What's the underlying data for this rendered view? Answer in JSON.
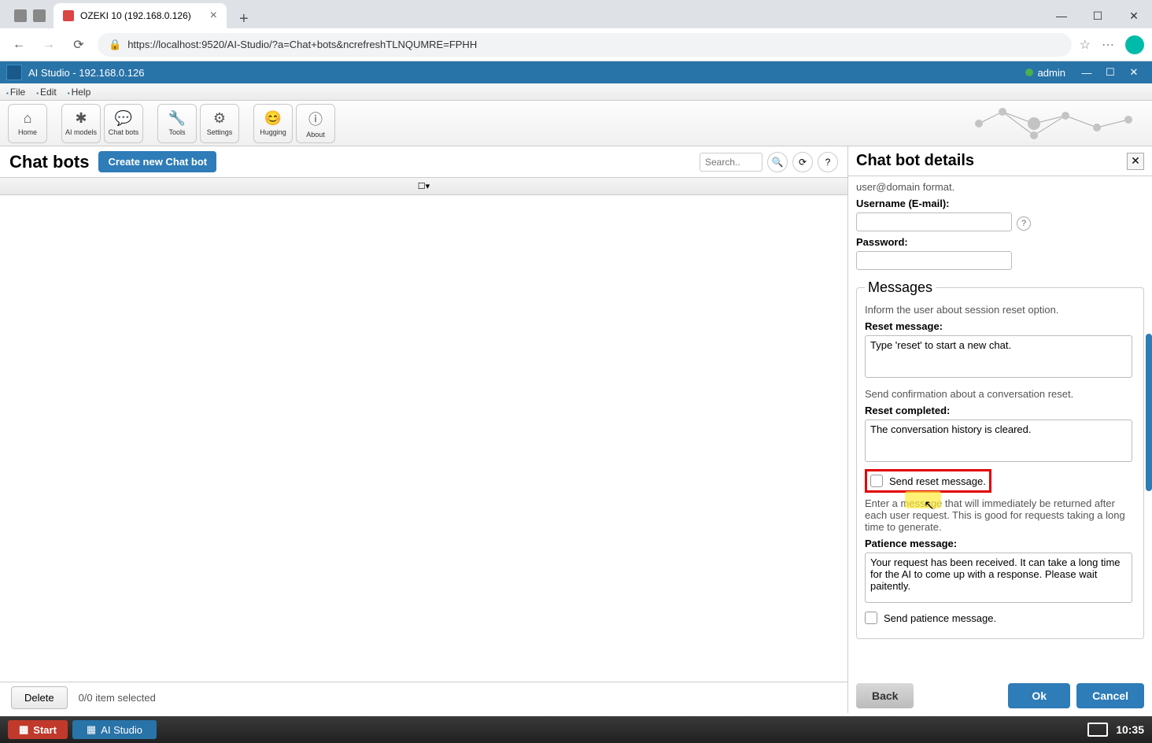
{
  "browser": {
    "tab_title": "OZEKI 10 (192.168.0.126)",
    "url": "https://localhost:9520/AI-Studio/?a=Chat+bots&ncrefreshTLNQUMRE=FPHH"
  },
  "app": {
    "title": "AI Studio - 192.168.0.126",
    "user": "admin"
  },
  "menu": {
    "file": "File",
    "edit": "Edit",
    "help": "Help"
  },
  "toolbar": {
    "home": "Home",
    "ai_models": "AI models",
    "chat_bots": "Chat bots",
    "tools": "Tools",
    "settings": "Settings",
    "hugging": "Hugging",
    "about": "About"
  },
  "left": {
    "title": "Chat bots",
    "create": "Create new Chat bot",
    "search_placeholder": "Search..",
    "delete": "Delete",
    "selection": "0/0 item selected"
  },
  "right": {
    "title": "Chat bot details",
    "top_hint": "user@domain format.",
    "username_label": "Username (E-mail):",
    "password_label": "Password:",
    "messages_legend": "Messages",
    "reset_info": "Inform the user about session reset option.",
    "reset_label": "Reset message:",
    "reset_value": "Type 'reset' to start a new chat.",
    "confirm_info": "Send confirmation about a conversation reset.",
    "completed_label": "Reset completed:",
    "completed_value": "The conversation history is cleared.",
    "send_reset": "Send reset message.",
    "patience_info": "Enter a message that will immediately be returned after each user request. This is good for requests taking a long time to generate.",
    "patience_label": "Patience message:",
    "patience_value": "Your request has been received. It can take a long time for the AI to come up with a response. Please wait paitently.",
    "send_patience": "Send patience message.",
    "back": "Back",
    "ok": "Ok",
    "cancel": "Cancel"
  },
  "taskbar": {
    "start": "Start",
    "app": "AI Studio",
    "clock": "10:35"
  }
}
